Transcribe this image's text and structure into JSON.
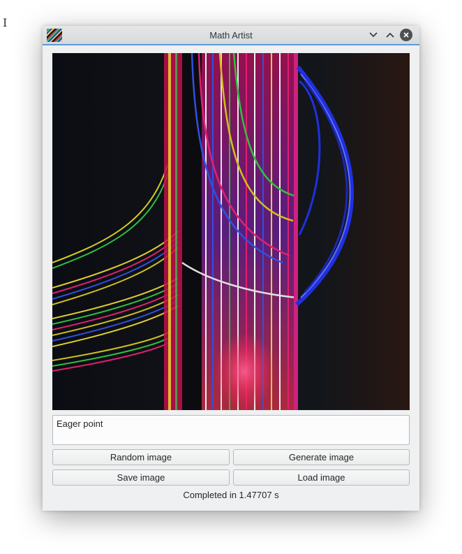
{
  "window": {
    "title": "Math Artist"
  },
  "expression": {
    "value": "Eager point"
  },
  "buttons": {
    "random": "Random image",
    "generate": "Generate image",
    "save": "Save image",
    "load": "Load image"
  },
  "status": {
    "text": "Completed in 1.47707 s"
  },
  "icons": {
    "app": "math-artist-app-icon",
    "minimize": "chevron-down-icon",
    "maximize": "chevron-up-icon",
    "close": "close-icon",
    "cursor": "text-cursor-icon"
  },
  "colors": {
    "accent": "#5b9bd5",
    "window_bg": "#eff0f1"
  }
}
